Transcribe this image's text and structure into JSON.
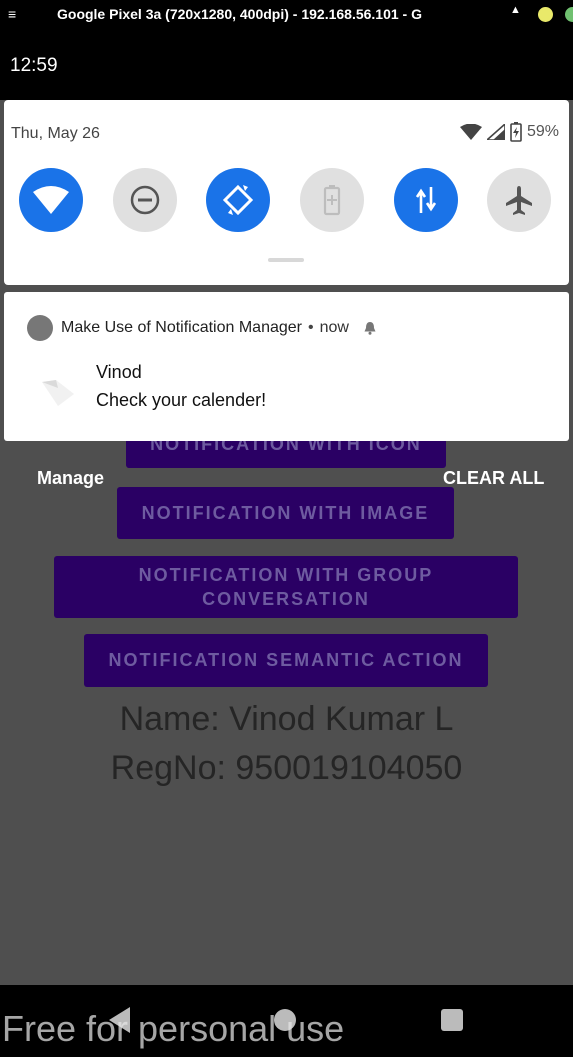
{
  "emulator": {
    "menu_glyph": "≡",
    "title": "Google Pixel 3a (720x1280, 400dpi) - 192.168.56.101 - G",
    "arrow_glyph": "▲"
  },
  "status_bar": {
    "time": "12:59"
  },
  "quick_settings": {
    "date": "Thu, May 26",
    "battery": "59%",
    "tiles": [
      {
        "name": "wifi",
        "state": "on"
      },
      {
        "name": "do-not-disturb",
        "state": "off"
      },
      {
        "name": "auto-rotate",
        "state": "on"
      },
      {
        "name": "battery-saver",
        "state": "off"
      },
      {
        "name": "mobile-data",
        "state": "on"
      },
      {
        "name": "airplane-mode",
        "state": "off"
      }
    ]
  },
  "notification": {
    "app_name": "Make Use of Notification Manager",
    "separator": "•",
    "time": "now",
    "title": "Vinod",
    "text": "Check your calender!"
  },
  "shade_actions": {
    "manage": "Manage",
    "clear_all": "CLEAR ALL"
  },
  "app": {
    "buttons": {
      "icon": "NOTIFICATION WITH ICON",
      "image": "NOTIFICATION WITH IMAGE",
      "group_line1": "NOTIFICATION WITH GROUP",
      "group_line2": "CONVERSATION",
      "semantic": "NOTIFICATION SEMANTIC ACTION"
    },
    "name_line": "Name: Vinod Kumar L",
    "regno_line": "RegNo: 950019104050"
  },
  "watermark": "Free for personal use",
  "colors": {
    "accent_blue": "#1a73e8",
    "tile_off": "#e0e0e0",
    "button_purple": "#2a0064",
    "scrim": "#4f4f4f"
  }
}
